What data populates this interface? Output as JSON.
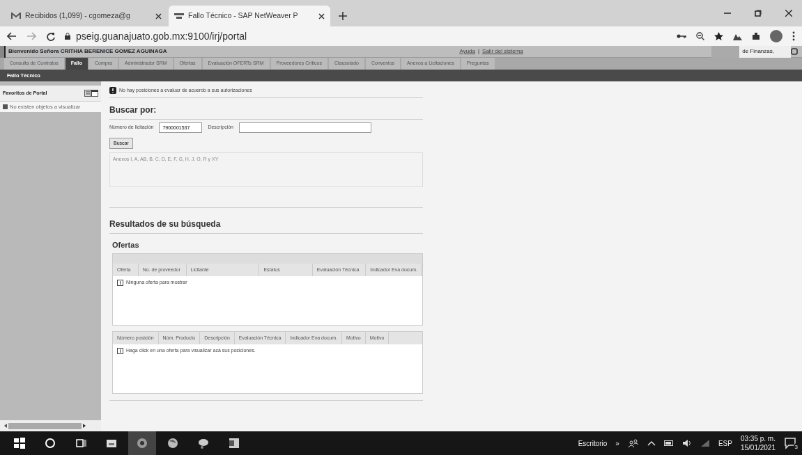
{
  "browser": {
    "tabs": [
      {
        "title": "Recibidos (1,099) - cgomeza@g",
        "selected": false
      },
      {
        "title": "Fallo Técnico - SAP NetWeaver P",
        "selected": true
      }
    ],
    "url": "pseig.guanajuato.gob.mx:9100/irj/portal"
  },
  "portal": {
    "welcome": "Bienvenido Señora CRITHIA BERENICE GOMEZ AGUINAGA",
    "links": [
      "Ayuda",
      "Salir del sistema"
    ],
    "link_separator": "|",
    "org": "de Finanzas,",
    "nav": [
      {
        "label": "Consulta de Contratos",
        "selected": false
      },
      {
        "label": "Fallo",
        "selected": true
      },
      {
        "label": "Compra",
        "selected": false
      },
      {
        "label": "Administrador SRM",
        "selected": false
      },
      {
        "label": "Ofertas",
        "selected": false
      },
      {
        "label": "Evaluación OFERTs SRM",
        "selected": false
      },
      {
        "label": "Proveedores Críticos",
        "selected": false
      },
      {
        "label": "Clausulado",
        "selected": false
      },
      {
        "label": "Convenios",
        "selected": false
      },
      {
        "label": "Anexos a Licitaciones",
        "selected": false
      },
      {
        "label": "Preguntas",
        "selected": false
      }
    ],
    "subtitle": "Fallo Técnico"
  },
  "sidebar": {
    "title": "Favoritos de Portal",
    "message": "No existen objetos a visualizar"
  },
  "content": {
    "notice": "No hay posiciones a evaluar de acuerdo a sus autorizaciones",
    "search": {
      "title": "Buscar por:",
      "fields": [
        {
          "label": "Número de licitación",
          "value": "7900001537"
        },
        {
          "label": "Descripción"
        }
      ],
      "button": "Buscar",
      "annex": "Anexos I, A, AB, B, C, D, E, F, G, H, J, O, R y XY"
    },
    "results": {
      "title": "Resultados de su búsqueda",
      "offers_title": "Ofertas",
      "offers_table": {
        "columns": [
          "Oferta",
          "No. de proveedor",
          "Licitante",
          "Estatus",
          "Evaluación Técnica",
          "Indicador Eva docum."
        ],
        "empty": "Ninguna oferta para mostrar"
      },
      "positions_table": {
        "columns": [
          "Número posición",
          "Núm. Producto",
          "Descripción",
          "Evaluación Técnica",
          "Indicador Eva docum.",
          "Motivo",
          "Motivo"
        ],
        "empty": "Haga click en una oferta para visualizar acá sus posiciones."
      }
    }
  },
  "taskbar": {
    "desktop": "Escritorio",
    "chevron": "»",
    "language": "ESP",
    "time": "03:35 p. m.",
    "date": "15/01/2021",
    "notifications": "3"
  }
}
